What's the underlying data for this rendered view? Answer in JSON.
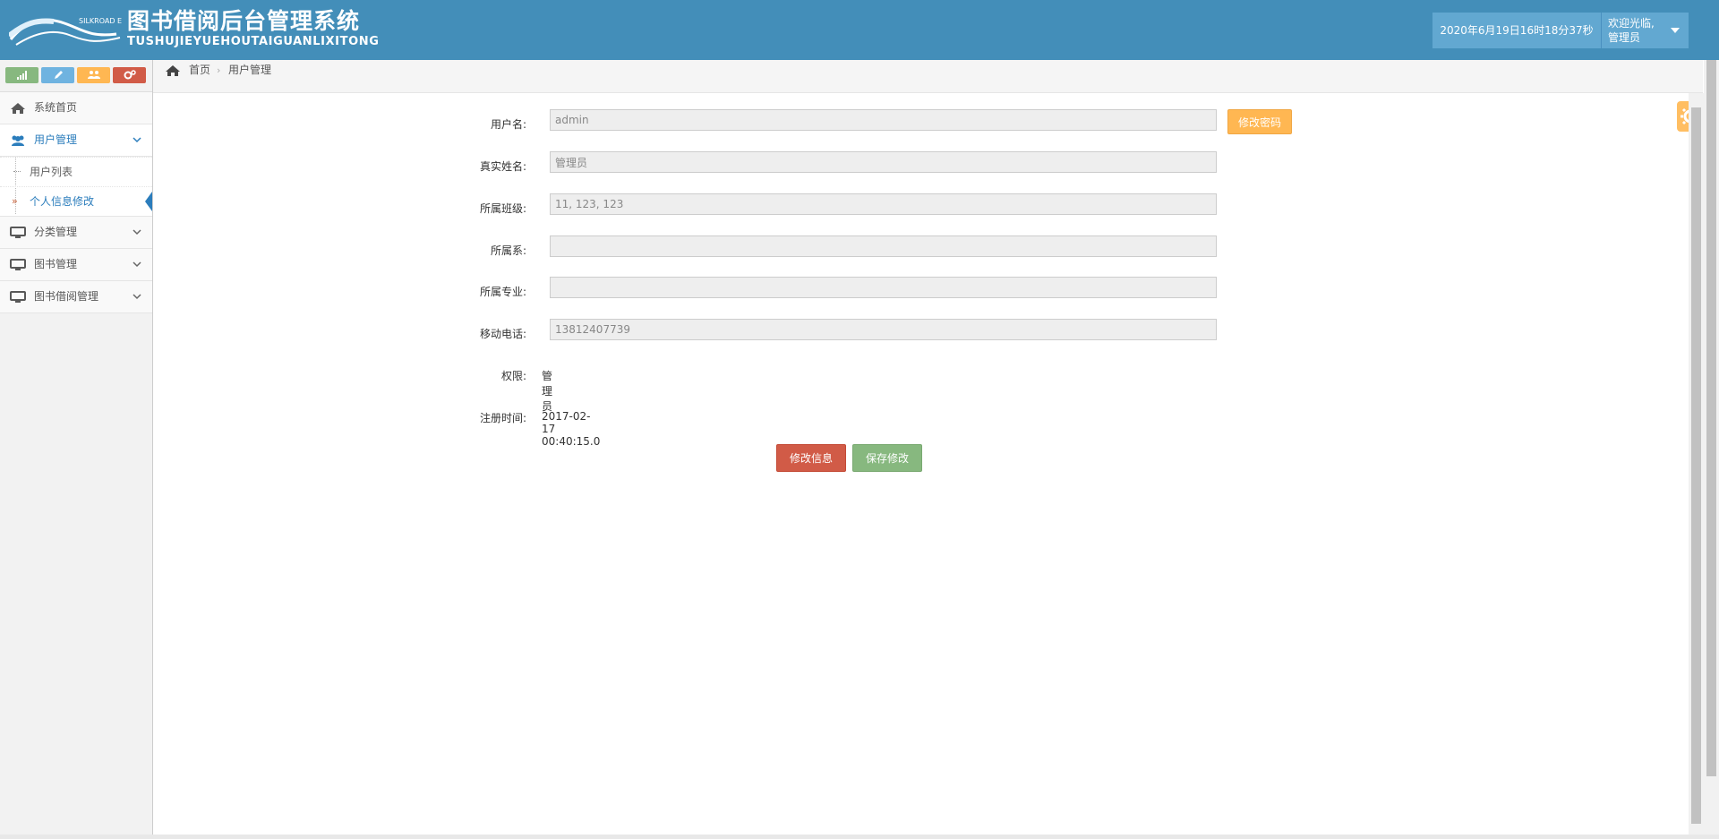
{
  "header": {
    "logo_brand": "SILKROAD EDU",
    "title_cn": "图书借阅后台管理系统",
    "title_pinyin": "TUSHUJIEYUEHOUTAIGUANLIXITONG",
    "datetime": "2020年6月19日16时18分37秒",
    "welcome_line1": "欢迎光临,",
    "welcome_line2": "管理员"
  },
  "colors": {
    "header_bg": "#438eb9",
    "accent_blue": "#2b7dbc",
    "warn": "#ffb752",
    "danger": "#d15b47",
    "success": "#87b87f"
  },
  "shortcuts": [
    {
      "icon": "signal-icon",
      "color": "#87b87f"
    },
    {
      "icon": "pencil-icon",
      "color": "#6fb3e0"
    },
    {
      "icon": "users-icon",
      "color": "#ffb752"
    },
    {
      "icon": "cogs-icon",
      "color": "#d15b47"
    }
  ],
  "sidebar": {
    "items": [
      {
        "label": "系统首页",
        "icon": "home-icon"
      },
      {
        "label": "用户管理",
        "icon": "users-icon"
      },
      {
        "label": "分类管理",
        "icon": "desktop-icon"
      },
      {
        "label": "图书管理",
        "icon": "desktop-icon"
      },
      {
        "label": "图书借阅管理",
        "icon": "desktop-icon"
      }
    ],
    "user_submenu": [
      {
        "label": "用户列表"
      },
      {
        "label": "个人信息修改"
      }
    ]
  },
  "breadcrumb": {
    "home": "首页",
    "current": "用户管理"
  },
  "form": {
    "username_label": "用户名:",
    "username_value": "admin",
    "change_password_label": "修改密码",
    "realname_label": "真实姓名:",
    "realname_value": "管理员",
    "class_label": "所属班级:",
    "class_value": "11, 123, 123",
    "dept_label": "所属系:",
    "dept_value": "",
    "major_label": "所属专业:",
    "major_value": "",
    "phone_label": "移动电话:",
    "phone_value": "13812407739",
    "role_label": "权限:",
    "role_value": "管理员",
    "regtime_label": "注册时间:",
    "regtime_value": "2017-02-17 00:40:15.0",
    "edit_button": "修改信息",
    "save_button": "保存修改"
  }
}
